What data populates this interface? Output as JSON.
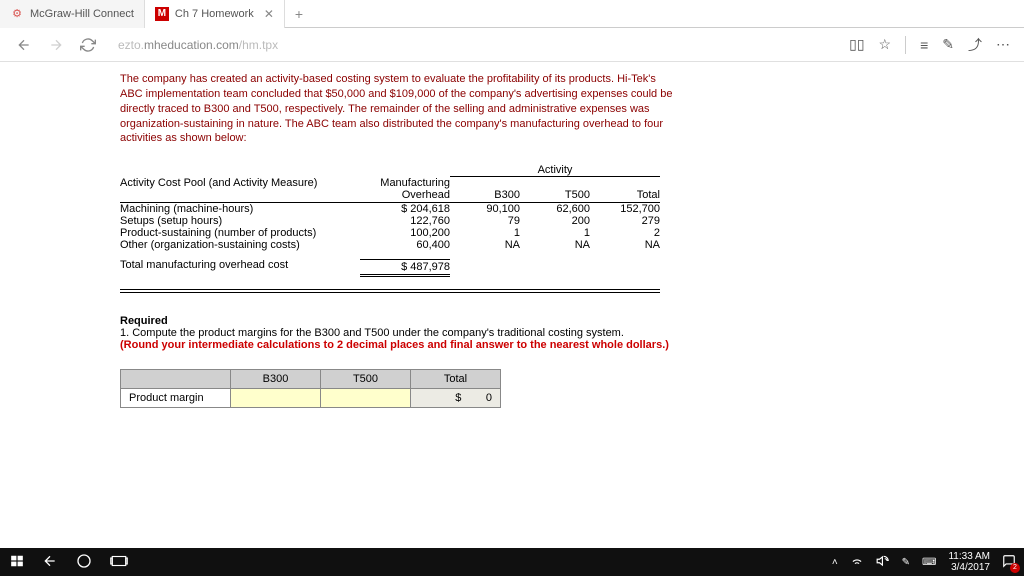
{
  "browser": {
    "tabs": [
      {
        "title": "McGraw-Hill Connect",
        "favicon": "⚙",
        "faviconColor": "#d9534f"
      },
      {
        "title": "Ch 7 Homework",
        "favicon": "M",
        "faviconColor": "#c00"
      }
    ],
    "url_host": "ezto.mheducation.com",
    "url_path": "/hm.tpx"
  },
  "intro": "The company has created an activity-based costing system to evaluate the profitability of its products. Hi-Tek's ABC implementation team concluded that $50,000 and $109,000 of the company's advertising expenses could be directly traced to B300 and T500, respectively. The remainder of the selling and administrative expenses was organization-sustaining in nature. The ABC team also distributed the company's manufacturing overhead to four activities as shown below:",
  "table": {
    "activity_hdr": "Activity",
    "headers": {
      "c0": "Activity Cost Pool (and Activity Measure)",
      "c1top": "Manufacturing",
      "c1": "Overhead",
      "c2": "B300",
      "c3": "T500",
      "c4": "Total"
    },
    "rows": [
      {
        "c0": "Machining (machine-hours)",
        "c1": "$ 204,618",
        "c2": "90,100",
        "c3": "62,600",
        "c4": "152,700"
      },
      {
        "c0": "Setups (setup hours)",
        "c1": "122,760",
        "c2": "79",
        "c3": "200",
        "c4": "279"
      },
      {
        "c0": "Product-sustaining (number of products)",
        "c1": "100,200",
        "c2": "1",
        "c3": "1",
        "c4": "2"
      },
      {
        "c0": "Other (organization-sustaining costs)",
        "c1": "60,400",
        "c2": "NA",
        "c3": "NA",
        "c4": "NA"
      }
    ],
    "total_label": "Total manufacturing overhead cost",
    "total_value": "$ 487,978"
  },
  "required": {
    "heading": "Required",
    "q1": "1.  Compute the product margins for the B300 and T500 under the company's traditional costing system.",
    "note": "(Round your intermediate calculations to 2 decimal places and final answer to the nearest whole dollars.)"
  },
  "answer": {
    "cols": [
      "B300",
      "T500",
      "Total"
    ],
    "row_label": "Product margin",
    "currency": "$",
    "total": "0"
  },
  "taskbar": {
    "time": "11:33 AM",
    "date": "3/4/2017",
    "notif_count": "2"
  }
}
